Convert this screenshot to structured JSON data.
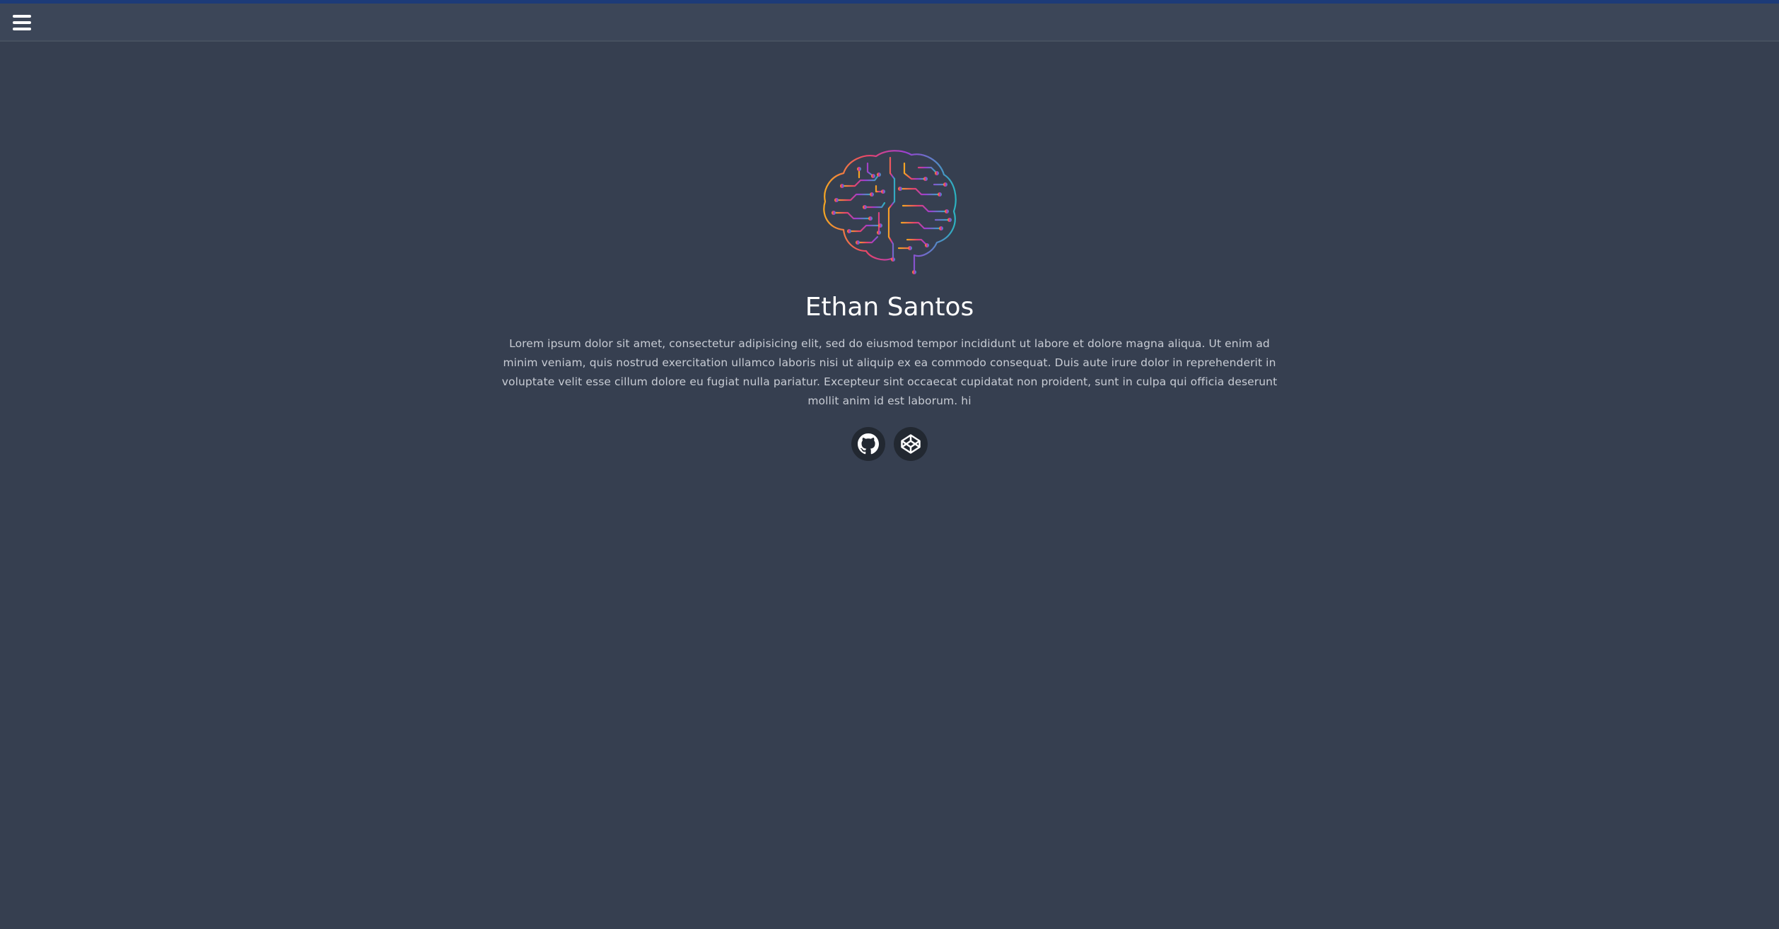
{
  "header": {
    "menu_icon": "hamburger-menu-icon"
  },
  "profile": {
    "logo_icon": "circuit-brain-icon",
    "name": "Ethan Santos",
    "bio": "Lorem ipsum dolor sit amet, consectetur adipisicing elit, sed do eiusmod tempor incididunt ut labore et dolore magna aliqua. Ut enim ad minim veniam, quis nostrud exercitation ullamco laboris nisi ut aliquip ex ea commodo consequat. Duis aute irure dolor in reprehenderit in voluptate velit esse cillum dolore eu fugiat nulla pariatur. Excepteur sint occaecat cupidatat non proident, sunt in culpa qui officia deserunt mollit anim id est laborum. hi"
  },
  "social_links": [
    {
      "icon": "github-icon"
    },
    {
      "icon": "codepen-icon"
    }
  ],
  "colors": {
    "background": "#363f50",
    "topbar": "#3c4658",
    "accent_bar": "#1d3b78",
    "social_button": "#222831",
    "brain_gradient": [
      "#f5a623",
      "#e9446a",
      "#9b3fd0",
      "#2bb3c0"
    ]
  }
}
